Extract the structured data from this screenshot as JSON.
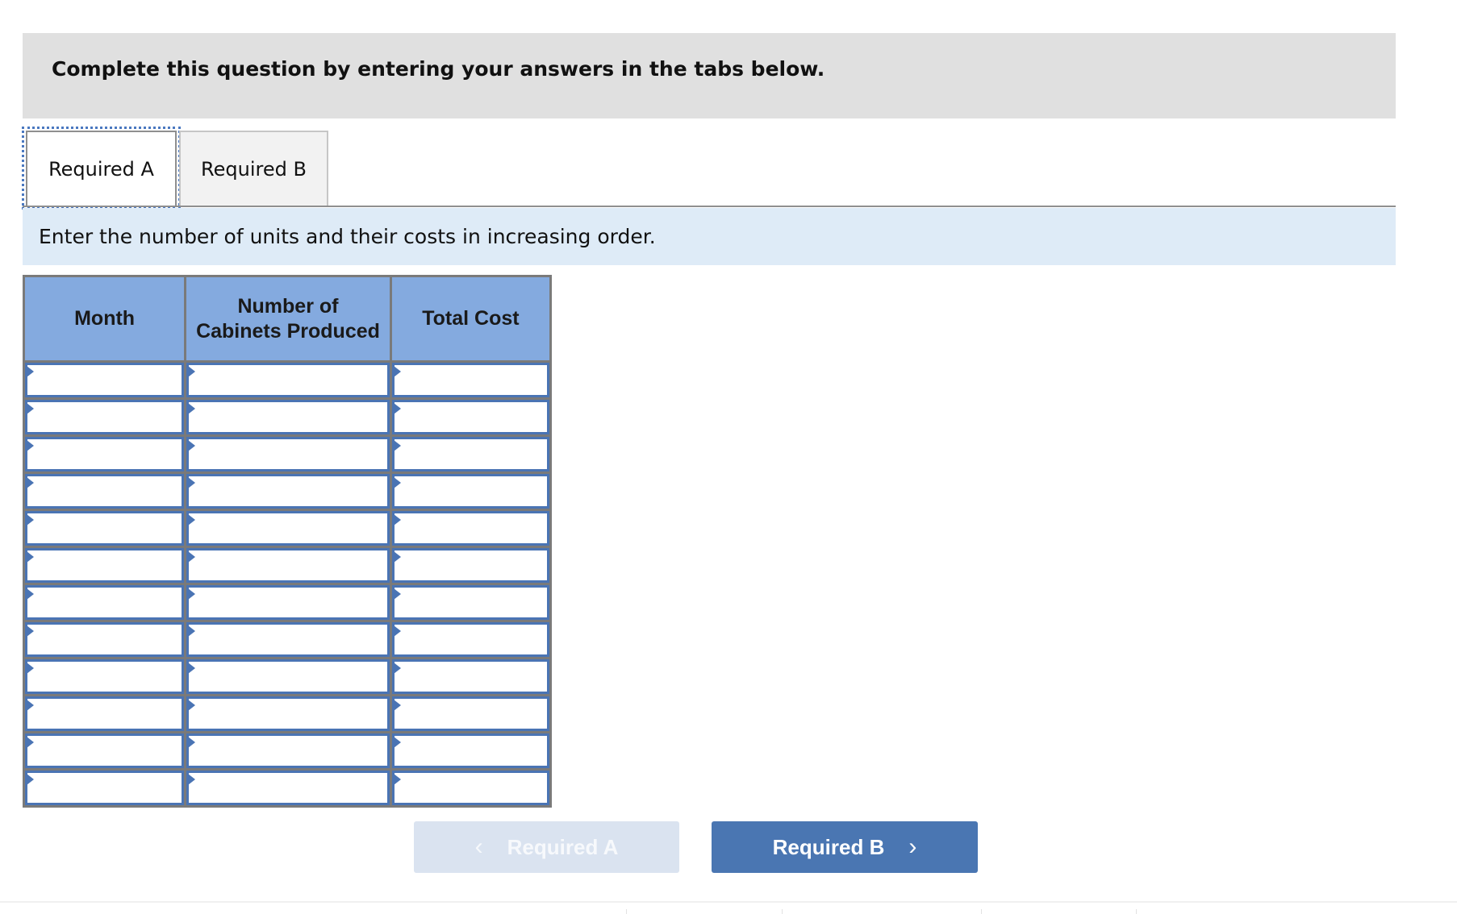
{
  "banner": {
    "instruction": "Complete this question by entering your answers in the tabs below."
  },
  "tabs": [
    {
      "label": "Required A",
      "active": true
    },
    {
      "label": "Required B",
      "active": false
    }
  ],
  "prompt": "Enter the number of units and their costs in increasing order.",
  "table": {
    "headers": [
      "Month",
      "Number of\nCabinets Produced",
      "Total Cost"
    ],
    "header_lines": {
      "month": "Month",
      "units_line1": "Number of",
      "units_line2": "Cabinets Produced",
      "total_cost": "Total Cost"
    },
    "rows": [
      {
        "month": "",
        "units": "",
        "total_cost": ""
      },
      {
        "month": "",
        "units": "",
        "total_cost": ""
      },
      {
        "month": "",
        "units": "",
        "total_cost": ""
      },
      {
        "month": "",
        "units": "",
        "total_cost": ""
      },
      {
        "month": "",
        "units": "",
        "total_cost": ""
      },
      {
        "month": "",
        "units": "",
        "total_cost": ""
      },
      {
        "month": "",
        "units": "",
        "total_cost": ""
      },
      {
        "month": "",
        "units": "",
        "total_cost": ""
      },
      {
        "month": "",
        "units": "",
        "total_cost": ""
      },
      {
        "month": "",
        "units": "",
        "total_cost": ""
      },
      {
        "month": "",
        "units": "",
        "total_cost": ""
      },
      {
        "month": "",
        "units": "",
        "total_cost": ""
      }
    ]
  },
  "navigation": {
    "prev_label": "Required A",
    "prev_icon": "chevron-left-icon",
    "prev_glyph": "‹",
    "prev_disabled": true,
    "next_label": "Required B",
    "next_icon": "chevron-right-icon",
    "next_glyph": "›"
  },
  "colors": {
    "accent": "#4a76b2",
    "header_fill": "#84aadf",
    "prompt_fill": "#deebf7",
    "banner_fill": "#e0e0e0"
  }
}
